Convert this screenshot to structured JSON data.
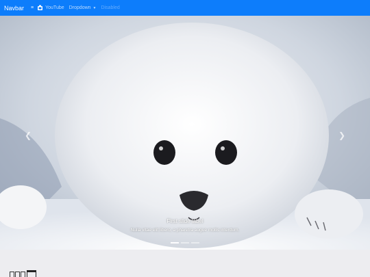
{
  "navbar": {
    "brand": "Navbar",
    "items": [
      {
        "label": "",
        "icon": "menu-icon"
      },
      {
        "label": "YouTube",
        "icon": "youtube-icon"
      },
      {
        "label": "Dropdown",
        "icon": "chevron-down-icon"
      },
      {
        "label": "Disabled"
      }
    ],
    "color": "#0d7dfb"
  },
  "carousel": {
    "caption_title": "First slide label",
    "caption_text": "Nulla vitae elit libero, a pharetra augue mollis interdum.",
    "prev_icon": "chevron-left-icon",
    "next_icon": "chevron-right-icon",
    "slide_count": 3,
    "active_index": 0
  },
  "below": {
    "icon": "calendar-icon"
  }
}
